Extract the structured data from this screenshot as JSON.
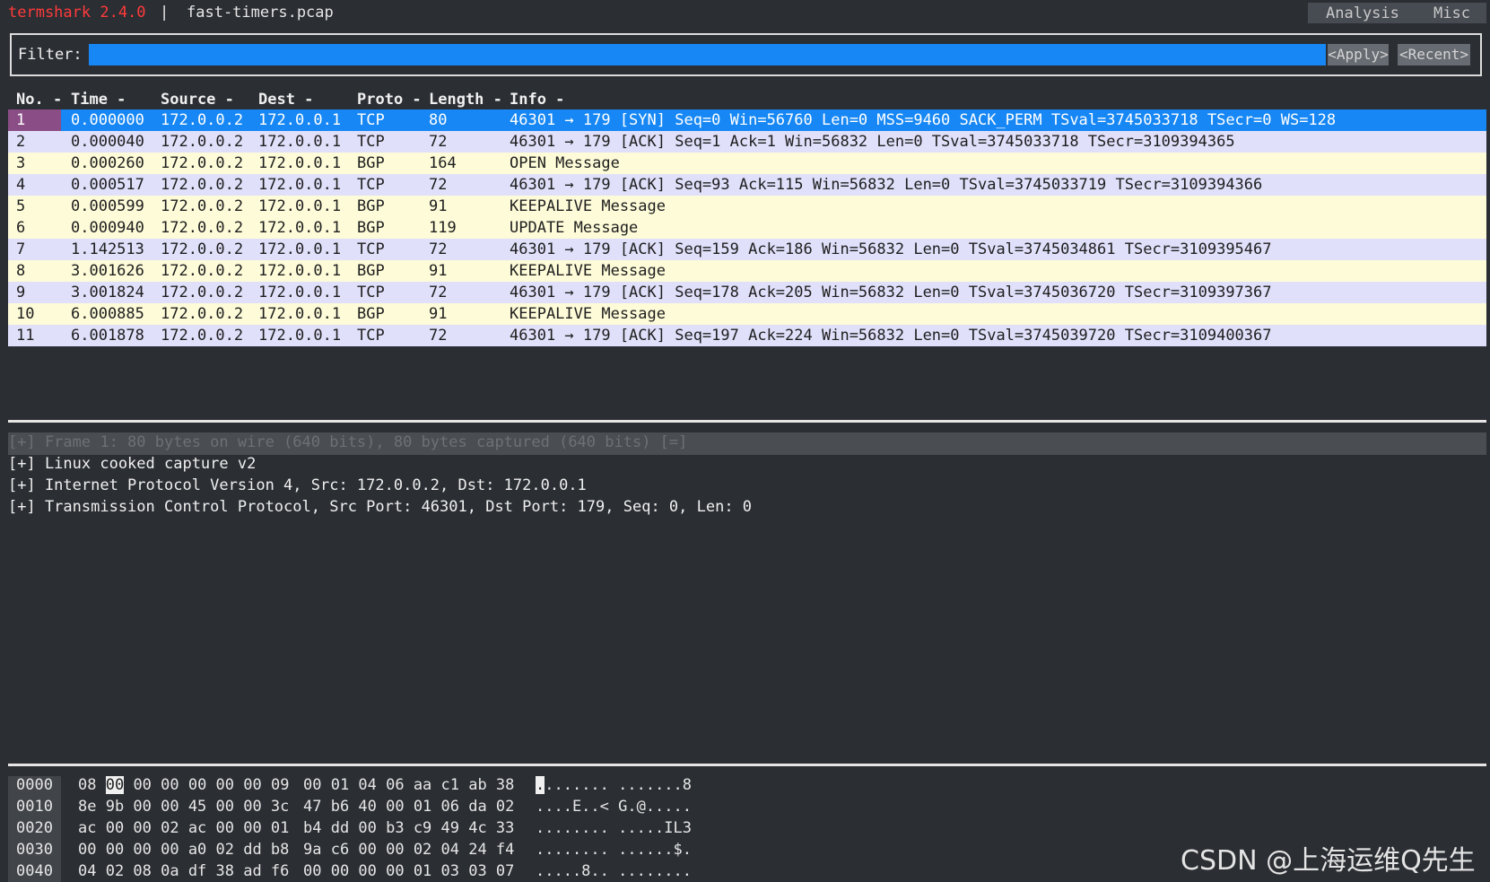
{
  "app": {
    "name": "termshark 2.4.0",
    "separator": "|",
    "file": "fast-timers.pcap"
  },
  "menu": {
    "analysis": "Analysis",
    "misc": "Misc"
  },
  "filter": {
    "label": "Filter:",
    "value": "",
    "apply": "<Apply>",
    "recent": "<Recent>"
  },
  "columns": [
    "No. -",
    "Time -",
    "Source -",
    "Dest -",
    "Proto -",
    "Length -",
    "Info -"
  ],
  "packets": [
    {
      "no": "1",
      "time": "0.000000",
      "src": "172.0.0.2",
      "dst": "172.0.0.1",
      "proto": "TCP",
      "len": "80",
      "info": "46301 → 179 [SYN] Seq=0 Win=56760 Len=0 MSS=9460 SACK_PERM TSval=3745033718 TSecr=0 WS=128"
    },
    {
      "no": "2",
      "time": "0.000040",
      "src": "172.0.0.2",
      "dst": "172.0.0.1",
      "proto": "TCP",
      "len": "72",
      "info": "46301 → 179 [ACK] Seq=1 Ack=1 Win=56832 Len=0 TSval=3745033718 TSecr=3109394365"
    },
    {
      "no": "3",
      "time": "0.000260",
      "src": "172.0.0.2",
      "dst": "172.0.0.1",
      "proto": "BGP",
      "len": "164",
      "info": "OPEN Message"
    },
    {
      "no": "4",
      "time": "0.000517",
      "src": "172.0.0.2",
      "dst": "172.0.0.1",
      "proto": "TCP",
      "len": "72",
      "info": "46301 → 179 [ACK] Seq=93 Ack=115 Win=56832 Len=0 TSval=3745033719 TSecr=3109394366"
    },
    {
      "no": "5",
      "time": "0.000599",
      "src": "172.0.0.2",
      "dst": "172.0.0.1",
      "proto": "BGP",
      "len": "91",
      "info": "KEEPALIVE Message"
    },
    {
      "no": "6",
      "time": "0.000940",
      "src": "172.0.0.2",
      "dst": "172.0.0.1",
      "proto": "BGP",
      "len": "119",
      "info": "UPDATE Message"
    },
    {
      "no": "7",
      "time": "1.142513",
      "src": "172.0.0.2",
      "dst": "172.0.0.1",
      "proto": "TCP",
      "len": "72",
      "info": "46301 → 179 [ACK] Seq=159 Ack=186 Win=56832 Len=0 TSval=3745034861 TSecr=3109395467"
    },
    {
      "no": "8",
      "time": "3.001626",
      "src": "172.0.0.2",
      "dst": "172.0.0.1",
      "proto": "BGP",
      "len": "91",
      "info": "KEEPALIVE Message"
    },
    {
      "no": "9",
      "time": "3.001824",
      "src": "172.0.0.2",
      "dst": "172.0.0.1",
      "proto": "TCP",
      "len": "72",
      "info": "46301 → 179 [ACK] Seq=178 Ack=205 Win=56832 Len=0 TSval=3745036720 TSecr=3109397367"
    },
    {
      "no": "10",
      "time": "6.000885",
      "src": "172.0.0.2",
      "dst": "172.0.0.1",
      "proto": "BGP",
      "len": "91",
      "info": "KEEPALIVE Message"
    },
    {
      "no": "11",
      "time": "6.001878",
      "src": "172.0.0.2",
      "dst": "172.0.0.1",
      "proto": "TCP",
      "len": "72",
      "info": "46301 → 179 [ACK] Seq=197 Ack=224 Win=56832 Len=0 TSval=3745039720 TSecr=3109400367"
    }
  ],
  "details": [
    "[+] Frame 1: 80 bytes on wire (640 bits), 80 bytes captured (640 bits) [=]",
    "[+] Linux cooked capture v2",
    "[+] Internet Protocol Version 4, Src: 172.0.0.2, Dst: 172.0.0.1",
    "[+] Transmission Control Protocol, Src Port: 46301, Dst Port: 179, Seq: 0, Len: 0"
  ],
  "hex": [
    {
      "offset": "0000",
      "b1": "08 00 00 00 00 00 00 09",
      "b2": "00 01 04 06 aa c1 ab 38",
      "ascii": "........ .......8"
    },
    {
      "offset": "0010",
      "b1": "8e 9b 00 00 45 00 00 3c",
      "b2": "47 b6 40 00 01 06 da 02",
      "ascii": "....E..< G.@....."
    },
    {
      "offset": "0020",
      "b1": "ac 00 00 02 ac 00 00 01",
      "b2": "b4 dd 00 b3 c9 49 4c 33",
      "ascii": "........ .....IL3"
    },
    {
      "offset": "0030",
      "b1": "00 00 00 00 a0 02 dd b8",
      "b2": "9a c6 00 00 02 04 24 f4",
      "ascii": "........ ......$."
    },
    {
      "offset": "0040",
      "b1": "04 02 08 0a df 38 ad f6",
      "b2": "00 00 00 00 01 03 03 07",
      "ascii": ".....8.. ........"
    }
  ],
  "watermark": "CSDN @上海运维Q先生",
  "colors": {
    "selected": "#1687f4",
    "tcp_row": "#e0e0fb",
    "bgp_row": "#fdfbd8",
    "title": "#ff3b3b",
    "row_marker": "#8b4d85"
  }
}
